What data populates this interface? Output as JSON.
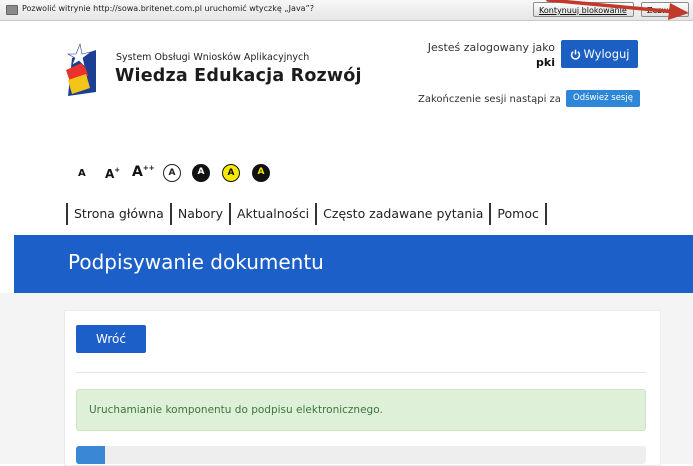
{
  "plugin_bar": {
    "message": "Pozwolić witrynie http://sowa.britenet.com.pl uruchomić wtyczkę „Java”?",
    "continue_label": "Kontynuuj blokowanie",
    "close_label": "Zezwól..."
  },
  "header": {
    "subtitle": "System Obsługi Wniosków Aplikacyjnych",
    "title": "Wiedza Edukacja Rozwój",
    "user_label": "Jesteś zalogowany jako",
    "user_name": "pki",
    "logout_label": "Wyloguj",
    "session_label": "Zakończenie sesji nastąpi za",
    "refresh_label": "Odśwież sesję"
  },
  "accessibility": {
    "font_small": "A",
    "font_medium": "A",
    "font_medium_sup": "+",
    "font_large": "A",
    "font_large_sup": "++",
    "contrast_labels": [
      "A",
      "A",
      "A",
      "A"
    ]
  },
  "nav": {
    "items": [
      "Strona główna",
      "Nabory",
      "Aktualności",
      "Często zadawane pytania",
      "Pomoc"
    ]
  },
  "page": {
    "title": "Podpisywanie dokumentu",
    "back_label": "Wróć",
    "alert_text": "Uruchamianie komponentu do podpisu elektronicznego.",
    "progress_fraction": 0.05
  },
  "colors": {
    "brand_blue": "#1c5fc9",
    "alert_green_bg": "#dff0d8",
    "alert_green_text": "#3c763d",
    "annotation_red": "#c0392b"
  }
}
